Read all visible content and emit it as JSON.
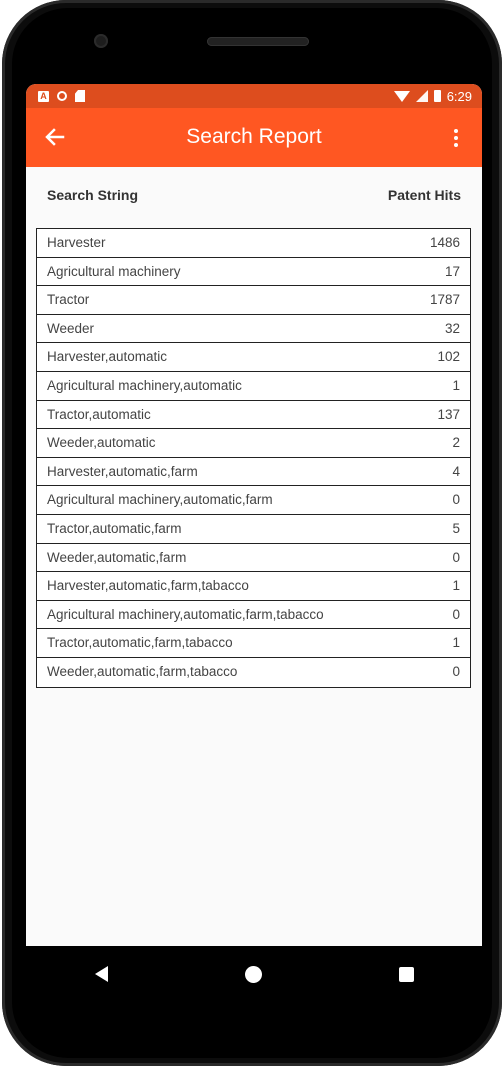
{
  "status_bar": {
    "time": "6:29",
    "left_icons": [
      "notification-a-icon",
      "circle-icon",
      "sd-card-icon"
    ],
    "right_icons": [
      "wifi-icon",
      "signal-icon",
      "battery-icon"
    ]
  },
  "toolbar": {
    "title": "Search Report",
    "back_icon": "arrow-left-icon",
    "menu_icon": "more-vertical-icon"
  },
  "table": {
    "header_left": "Search String",
    "header_right": "Patent Hits",
    "rows": [
      {
        "term": "Harvester",
        "hits": "1486"
      },
      {
        "term": "Agricultural machinery",
        "hits": "17"
      },
      {
        "term": "Tractor",
        "hits": "1787"
      },
      {
        "term": "Weeder",
        "hits": "32"
      },
      {
        "term": "Harvester,automatic",
        "hits": "102"
      },
      {
        "term": "Agricultural machinery,automatic",
        "hits": "1"
      },
      {
        "term": "Tractor,automatic",
        "hits": "137"
      },
      {
        "term": "Weeder,automatic",
        "hits": "2"
      },
      {
        "term": "Harvester,automatic,farm",
        "hits": "4"
      },
      {
        "term": "Agricultural machinery,automatic,farm",
        "hits": "0"
      },
      {
        "term": "Tractor,automatic,farm",
        "hits": "5"
      },
      {
        "term": "Weeder,automatic,farm",
        "hits": "0"
      },
      {
        "term": "Harvester,automatic,farm,tabacco",
        "hits": "1"
      },
      {
        "term": "Agricultural machinery,automatic,farm,tabacco",
        "hits": "0"
      },
      {
        "term": "Tractor,automatic,farm,tabacco",
        "hits": "1"
      },
      {
        "term": "Weeder,automatic,farm,tabacco",
        "hits": "0"
      }
    ]
  },
  "nav_bar": {
    "buttons": [
      "nav-back-icon",
      "nav-home-icon",
      "nav-recents-icon"
    ]
  },
  "colors": {
    "toolbar": "#ff5722",
    "status_bar": "#dd4d1e",
    "background": "#fafafa"
  }
}
